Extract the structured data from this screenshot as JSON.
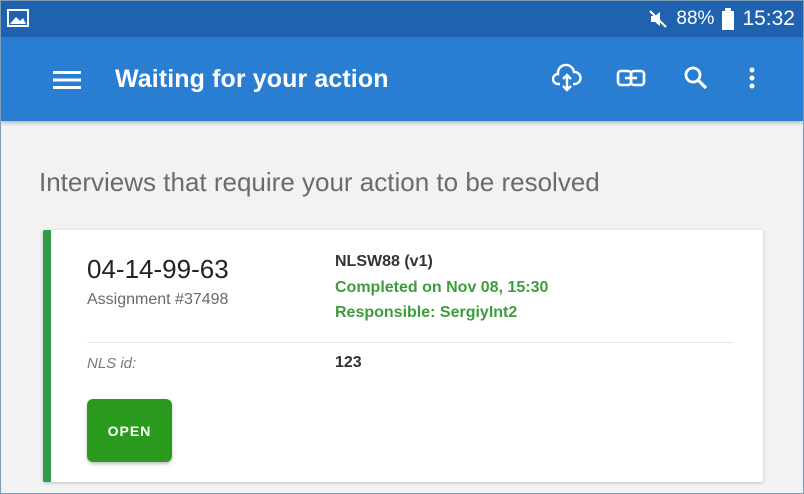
{
  "status_bar": {
    "battery_percent": "88%",
    "time": "15:32",
    "icons": [
      "gallery-icon",
      "mute-icon",
      "battery-icon"
    ]
  },
  "app_bar": {
    "title": "Waiting for your action",
    "icons": [
      "menu-icon",
      "cloud-sync-icon",
      "link-icon",
      "search-icon",
      "more-vert-icon"
    ]
  },
  "main": {
    "heading": "Interviews that require your action to be resolved"
  },
  "card": {
    "key": "04-14-99-63",
    "assignment": "Assignment #37498",
    "questionnaire": "NLSW88 (v1)",
    "completed": "Completed on Nov 08, 15:30",
    "responsible": "Responsible: SergiyInt2",
    "prefilled_label": "NLS id:",
    "prefilled_value": "123",
    "open_label": "OPEN",
    "status_color": "#2f9a48"
  },
  "colors": {
    "status_bar": "#1f62b0",
    "app_bar": "#2a7ed2",
    "open_button": "#2a9a1e",
    "completed_text": "#3d9d3d"
  }
}
